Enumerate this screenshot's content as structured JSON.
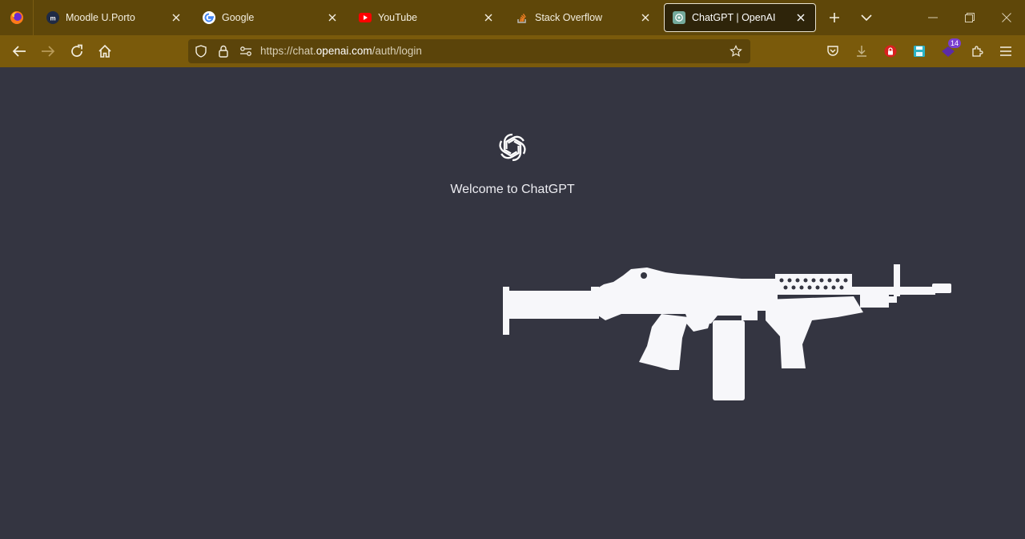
{
  "browser": {
    "tabs": [
      {
        "label": "Moodle U.Porto",
        "icon": "moodle-icon"
      },
      {
        "label": "Google",
        "icon": "google-icon"
      },
      {
        "label": "YouTube",
        "icon": "youtube-icon"
      },
      {
        "label": "Stack Overflow",
        "icon": "stackoverflow-icon"
      },
      {
        "label": "ChatGPT | OpenAI",
        "icon": "openai-icon",
        "active": true
      }
    ],
    "url_prefix": "https://chat.",
    "url_domain": "openai.com",
    "url_path": "/auth/login",
    "extension_badge": "14"
  },
  "page": {
    "welcome_text": "Welcome to ChatGPT"
  },
  "colors": {
    "tabbar": "#5f4709",
    "navbar": "#7a5a0b",
    "urlbar": "#5b440a",
    "page_background": "#343541",
    "text": "#ececf1"
  }
}
